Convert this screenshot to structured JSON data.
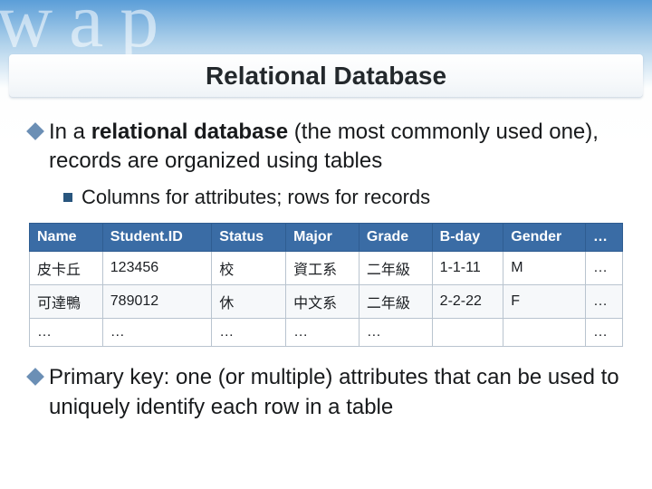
{
  "watermark": "wap",
  "title": "Relational Database",
  "bullets": {
    "b1_pre": "In a ",
    "b1_bold": "relational database",
    "b1_post": " (the most commonly used one), records are organized using tables",
    "b1_sub": "Columns for attributes; rows for records",
    "b2": "Primary key:  one (or multiple) attributes that can be used to uniquely identify each row in a table"
  },
  "table": {
    "headers": [
      "Name",
      "Student.ID",
      "Status",
      "Major",
      "Grade",
      "B-day",
      "Gender",
      "…"
    ],
    "rows": [
      [
        "皮卡丘",
        "123456",
        "校",
        "資工系",
        "二年級",
        "1-1-11",
        "M",
        "…"
      ],
      [
        "可達鴨",
        "789012",
        "休",
        "中文系",
        "二年級",
        "2-2-22",
        "F",
        "…"
      ],
      [
        "…",
        "…",
        "…",
        "…",
        "…",
        "",
        "",
        "…"
      ]
    ]
  }
}
